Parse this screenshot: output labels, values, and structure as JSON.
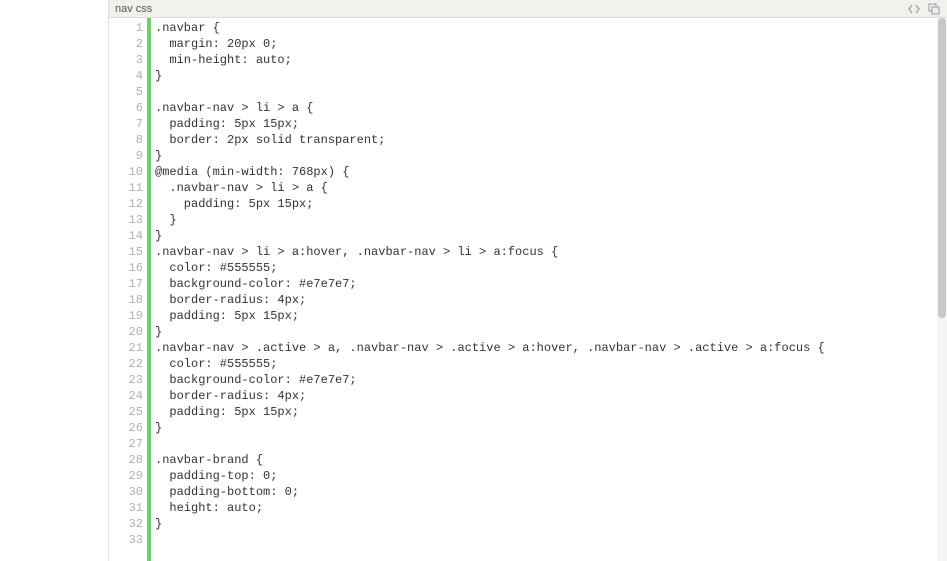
{
  "header": {
    "title": "nav css"
  },
  "code": {
    "lines": [
      {
        "n": 1,
        "t": ".navbar {"
      },
      {
        "n": 2,
        "t": "  margin: 20px 0;"
      },
      {
        "n": 3,
        "t": "  min-height: auto;"
      },
      {
        "n": 4,
        "t": "}"
      },
      {
        "n": 5,
        "t": ""
      },
      {
        "n": 6,
        "t": ".navbar-nav > li > a {"
      },
      {
        "n": 7,
        "t": "  padding: 5px 15px;"
      },
      {
        "n": 8,
        "t": "  border: 2px solid transparent;"
      },
      {
        "n": 9,
        "t": "}"
      },
      {
        "n": 10,
        "t": "@media (min-width: 768px) {"
      },
      {
        "n": 11,
        "t": "  .navbar-nav > li > a {"
      },
      {
        "n": 12,
        "t": "    padding: 5px 15px;"
      },
      {
        "n": 13,
        "t": "  }"
      },
      {
        "n": 14,
        "t": "}"
      },
      {
        "n": 15,
        "t": ".navbar-nav > li > a:hover, .navbar-nav > li > a:focus {"
      },
      {
        "n": 16,
        "t": "  color: #555555;"
      },
      {
        "n": 17,
        "t": "  background-color: #e7e7e7;"
      },
      {
        "n": 18,
        "t": "  border-radius: 4px;"
      },
      {
        "n": 19,
        "t": "  padding: 5px 15px;"
      },
      {
        "n": 20,
        "t": "}"
      },
      {
        "n": 21,
        "t": ".navbar-nav > .active > a, .navbar-nav > .active > a:hover, .navbar-nav > .active > a:focus {"
      },
      {
        "n": 22,
        "t": "  color: #555555;"
      },
      {
        "n": 23,
        "t": "  background-color: #e7e7e7;"
      },
      {
        "n": 24,
        "t": "  border-radius: 4px;"
      },
      {
        "n": 25,
        "t": "  padding: 5px 15px;"
      },
      {
        "n": 26,
        "t": "}"
      },
      {
        "n": 27,
        "t": ""
      },
      {
        "n": 28,
        "t": ".navbar-brand {"
      },
      {
        "n": 29,
        "t": "  padding-top: 0;"
      },
      {
        "n": 30,
        "t": "  padding-bottom: 0;"
      },
      {
        "n": 31,
        "t": "  height: auto;"
      },
      {
        "n": 32,
        "t": "}"
      },
      {
        "n": 33,
        "t": ""
      }
    ]
  }
}
